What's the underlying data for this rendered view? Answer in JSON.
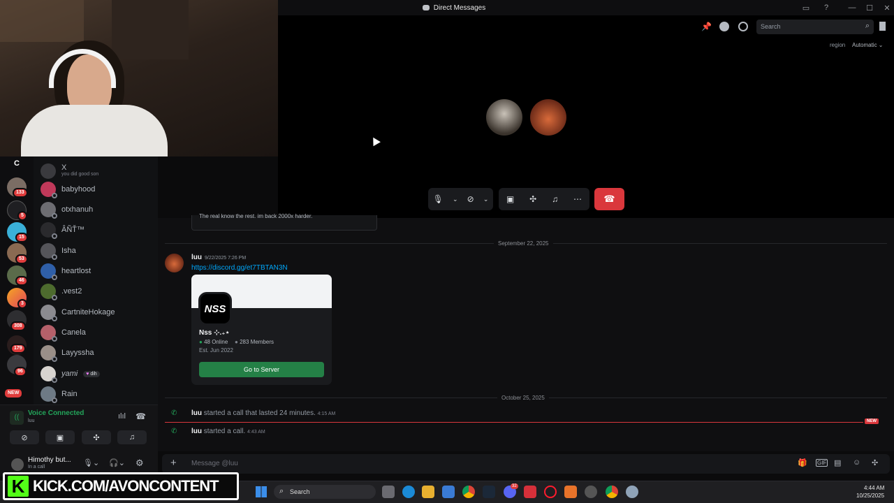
{
  "window": {
    "title": "Direct Messages"
  },
  "header": {
    "search_placeholder": "Search",
    "region_label": "region",
    "region_value": "Automatic"
  },
  "rail": {
    "top_label": "C",
    "badges": [
      "133",
      "5",
      "15",
      "53",
      "46",
      "3",
      "308",
      "179",
      "96"
    ],
    "new_label": "NEW"
  },
  "dms": {
    "items": [
      {
        "name": "X",
        "sub": "you did good son"
      },
      {
        "name": "babyhood"
      },
      {
        "name": "otxhanuh"
      },
      {
        "name": "ÂÑŤ™"
      },
      {
        "name": "Isha"
      },
      {
        "name": "heartlost"
      },
      {
        "name": ".vest2"
      },
      {
        "name": "CartniteHokage"
      },
      {
        "name": "Canela"
      },
      {
        "name": "Layyssha"
      },
      {
        "name": "yami",
        "tag": "dih"
      },
      {
        "name": "Rain"
      }
    ]
  },
  "voice": {
    "status": "Voice Connected",
    "channel": "luu"
  },
  "user": {
    "name": "Himothy but...",
    "status": "In a call"
  },
  "chat": {
    "prev_message": "The real know the rest. im back 2000x harder.",
    "date1": "September 22, 2025",
    "msg_author": "luu",
    "msg_time": "9/22/2025 7:26 PM",
    "msg_link": "https://discord.gg/et7TBTAN3N",
    "invite": {
      "server_name": "Nss ⊹.₊⋆",
      "online": "48 Online",
      "members": "283 Members",
      "est": "Est. Jun 2022",
      "button": "Go to Server",
      "logo_text": "NSS"
    },
    "date2": "October 25, 2025",
    "call1": {
      "author": "luu",
      "text": "started a call that lasted 24 minutes.",
      "time": "4:15 AM"
    },
    "call2": {
      "author": "luu",
      "text": "started a call.",
      "time": "4:43 AM"
    },
    "new_label": "NEW",
    "composer_placeholder": "Message @luu"
  },
  "overlay": {
    "kick_text": "KICK.COM/AVONCONTENT",
    "kick_letter": "K"
  },
  "taskbar": {
    "search": "Search",
    "time": "4:44 AM",
    "date": "10/25/2025",
    "notif": "32"
  },
  "colors": {
    "accent": "#5865f2",
    "danger": "#da373c",
    "green": "#23a55a",
    "link": "#00a8fc"
  }
}
